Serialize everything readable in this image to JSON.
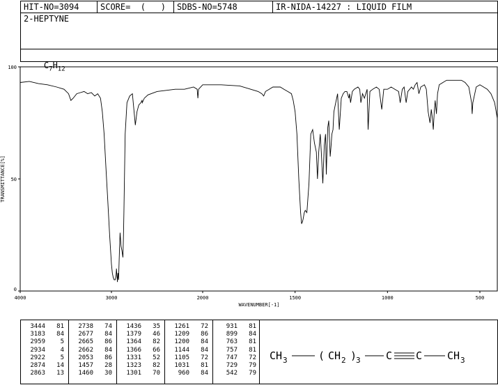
{
  "header": {
    "hit_no": "HIT-NO=3094",
    "score": "SCORE=  (   )",
    "sdbs_no": "SDBS-NO=5748",
    "ir_info": "IR-NIDA-14227 : LIQUID FILM"
  },
  "compound": {
    "name": "2-HEPTYNE",
    "formula_c": "C",
    "formula_c_sub": "7",
    "formula_h": "H",
    "formula_h_sub": "12"
  },
  "chart_data": {
    "type": "line",
    "xlabel": "WAVENUMBER[-1]",
    "ylabel": "TRANSMITTANCE[%]",
    "xlim": [
      4000,
      400
    ],
    "ylim": [
      0,
      100
    ],
    "x_reversed": true,
    "x_ticks": [
      4000,
      3000,
      2000,
      1500,
      1000,
      500
    ],
    "y_ticks": [
      0,
      50,
      100
    ],
    "grid": false,
    "series": [
      {
        "x": [
          4000,
          3900,
          3800,
          3700,
          3600,
          3520,
          3470,
          3444,
          3420,
          3380,
          3340,
          3300,
          3260,
          3220,
          3183,
          3150,
          3120,
          3100,
          3080,
          3060,
          3040,
          3020,
          3000,
          2990,
          2980,
          2970,
          2959,
          2950,
          2945,
          2934,
          2928,
          2922,
          2915,
          2905,
          2895,
          2885,
          2874,
          2868,
          2863,
          2850,
          2830,
          2800,
          2770,
          2738,
          2720,
          2700,
          2677,
          2665,
          2662,
          2640,
          2600,
          2500,
          2400,
          2300,
          2200,
          2100,
          2060,
          2053,
          2045,
          2000,
          1900,
          1800,
          1700,
          1680,
          1670,
          1660,
          1640,
          1620,
          1600,
          1580,
          1560,
          1540,
          1520,
          1510,
          1500,
          1490,
          1480,
          1470,
          1465,
          1460,
          1457,
          1450,
          1445,
          1436,
          1425,
          1415,
          1405,
          1395,
          1385,
          1379,
          1372,
          1368,
          1364,
          1358,
          1350,
          1342,
          1335,
          1331,
          1327,
          1323,
          1318,
          1310,
          1305,
          1301,
          1295,
          1290,
          1280,
          1270,
          1261,
          1250,
          1240,
          1230,
          1220,
          1209,
          1205,
          1200,
          1190,
          1180,
          1170,
          1160,
          1150,
          1144,
          1135,
          1125,
          1110,
          1105,
          1095,
          1080,
          1060,
          1045,
          1031,
          1020,
          1000,
          980,
          960,
          940,
          931,
          920,
          910,
          899,
          890,
          880,
          870,
          860,
          850,
          840,
          830,
          820,
          800,
          790,
          780,
          770,
          763,
          757,
          752,
          747,
          742,
          735,
          729,
          720,
          700,
          680,
          650,
          620,
          600,
          580,
          560,
          545,
          542,
          538,
          520,
          500,
          480,
          460,
          440,
          420,
          400
        ],
        "y": [
          93,
          93.5,
          92.5,
          92,
          91,
          90,
          88,
          85,
          86,
          88,
          88.5,
          89,
          88,
          88.5,
          87,
          88,
          86,
          80,
          70,
          55,
          40,
          25,
          12,
          8,
          6,
          5,
          5,
          7,
          10,
          4,
          8,
          5,
          14,
          26,
          20,
          18,
          15,
          25,
          35,
          70,
          84,
          87,
          88,
          74,
          80,
          83,
          84,
          85,
          84,
          86,
          87.5,
          89,
          89.5,
          90,
          90,
          91,
          90,
          86,
          90,
          92,
          92,
          91.5,
          89,
          88,
          87,
          89,
          90,
          91,
          91,
          91,
          90,
          89,
          88,
          85,
          80,
          70,
          50,
          35,
          30,
          31,
          32,
          35,
          36,
          35,
          48,
          70,
          72,
          66,
          62,
          50,
          62,
          66,
          70,
          62,
          48,
          65,
          70,
          52,
          64,
          73,
          76,
          60,
          65,
          70,
          72,
          80,
          84,
          88,
          72,
          86,
          88,
          89,
          89,
          86,
          88,
          84,
          89,
          90,
          90.5,
          91,
          90,
          84,
          88,
          86,
          90,
          72,
          89,
          90,
          91,
          90,
          81,
          90,
          90,
          91,
          90,
          89,
          84,
          90,
          91,
          84,
          89,
          90,
          91,
          90,
          92,
          93,
          88,
          91,
          92,
          90,
          80,
          75,
          81,
          77,
          72,
          80,
          85,
          79,
          88,
          92,
          93,
          94,
          94,
          94,
          94,
          93,
          91,
          84,
          79,
          84,
          91,
          92,
          91,
          90,
          88,
          84,
          77
        ]
      }
    ],
    "peak_table": [
      [
        [
          "3444",
          "81"
        ],
        [
          "3183",
          "84"
        ],
        [
          "2959",
          "5"
        ],
        [
          "2934",
          "4"
        ],
        [
          "2922",
          "5"
        ],
        [
          "2874",
          "14"
        ],
        [
          "2863",
          "13"
        ]
      ],
      [
        [
          "2738",
          "74"
        ],
        [
          "2677",
          "84"
        ],
        [
          "2665",
          "86"
        ],
        [
          "2662",
          "84"
        ],
        [
          "2053",
          "86"
        ],
        [
          "1457",
          "28"
        ],
        [
          "1460",
          "30"
        ]
      ],
      [
        [
          "1436",
          "35"
        ],
        [
          "1379",
          "46"
        ],
        [
          "1364",
          "82"
        ],
        [
          "1366",
          "66"
        ],
        [
          "1331",
          "52"
        ],
        [
          "1323",
          "82"
        ],
        [
          "1301",
          "70"
        ]
      ],
      [
        [
          "1261",
          "72"
        ],
        [
          "1209",
          "86"
        ],
        [
          "1200",
          "84"
        ],
        [
          "1144",
          "84"
        ],
        [
          "1105",
          "72"
        ],
        [
          "1031",
          "81"
        ],
        [
          "960",
          "84"
        ]
      ],
      [
        [
          "931",
          "81"
        ],
        [
          "899",
          "84"
        ],
        [
          "763",
          "81"
        ],
        [
          "757",
          "81"
        ],
        [
          "747",
          "72"
        ],
        [
          "729",
          "79"
        ],
        [
          "542",
          "79"
        ]
      ]
    ]
  },
  "structure": {
    "ch3_left": "CH",
    "ch3_left_sub": "3",
    "group_open": "(",
    "ch2": "CH",
    "ch2_sub": "2",
    "group_close": ")",
    "repeat": "3",
    "c1": "C",
    "c2": "C",
    "ch3_right": "CH",
    "ch3_right_sub": "3"
  }
}
